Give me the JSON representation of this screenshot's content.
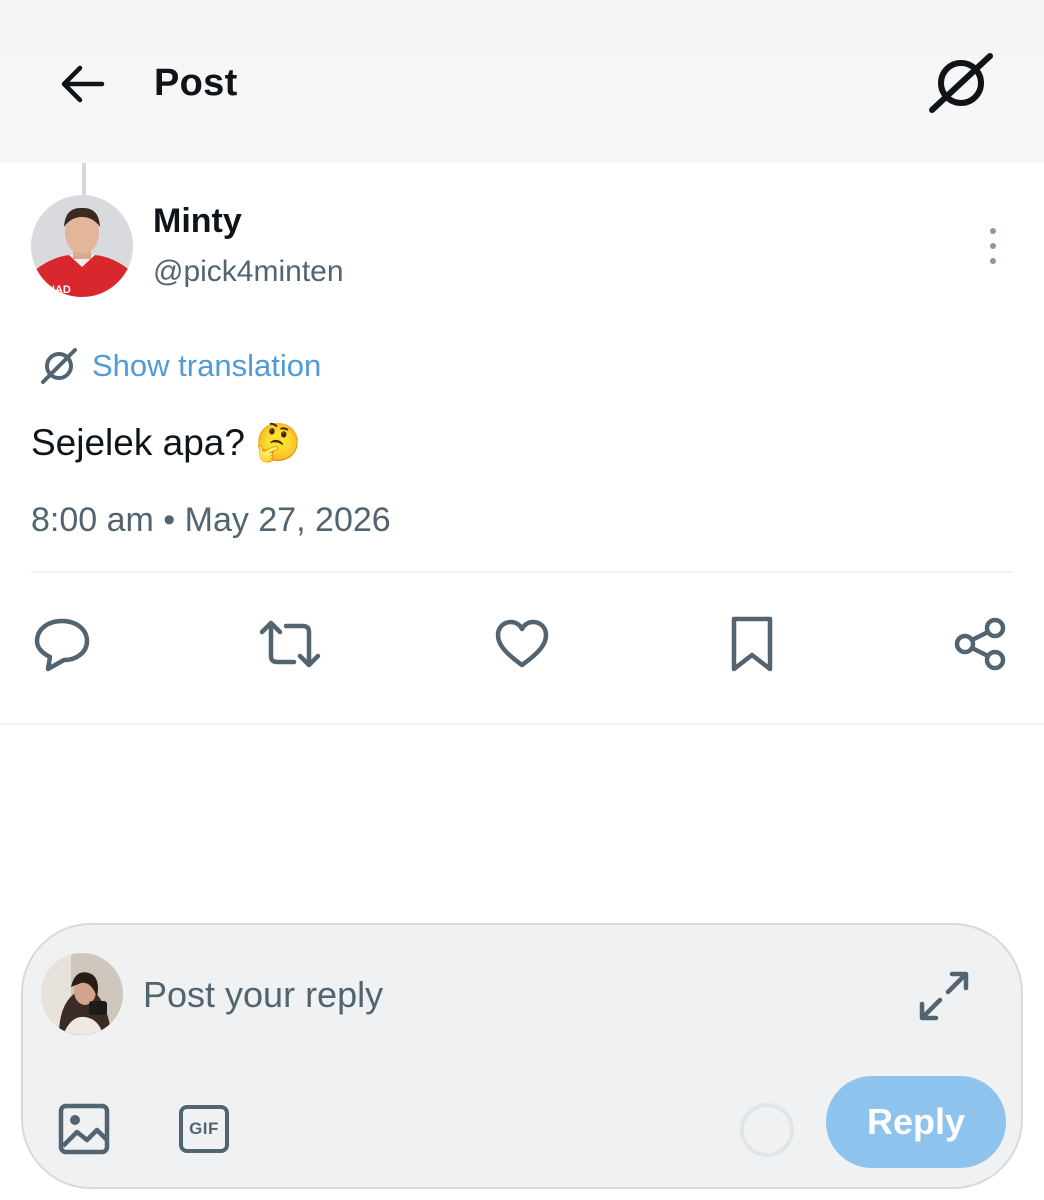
{
  "header": {
    "title": "Post",
    "back_icon": "arrow-left-icon",
    "translate_icon": "grok-translate-icon"
  },
  "post": {
    "author": {
      "display_name": "Minty",
      "handle": "@pick4minten",
      "avatar_icon": "avatar-hockey-player"
    },
    "more_icon": "more-vertical-icon",
    "translation_label": "Show translation",
    "text": "Sejelek apa? 🤔",
    "time": "8:00 am",
    "separator": "•",
    "date": "May 27, 2026",
    "meta": "8:00 am • May 27, 2026"
  },
  "actions": [
    {
      "name": "reply",
      "icon": "comment-icon"
    },
    {
      "name": "repost",
      "icon": "repost-icon"
    },
    {
      "name": "like",
      "icon": "heart-icon"
    },
    {
      "name": "bookmark",
      "icon": "bookmark-icon"
    },
    {
      "name": "share",
      "icon": "share-icon"
    }
  ],
  "composer": {
    "placeholder": "Post your reply",
    "gif_label": "GIF",
    "reply_button": "Reply",
    "colors": {
      "reply_button_bg": "#8ec3ee",
      "link": "#4f9bd9",
      "secondary_text": "#536471"
    }
  }
}
